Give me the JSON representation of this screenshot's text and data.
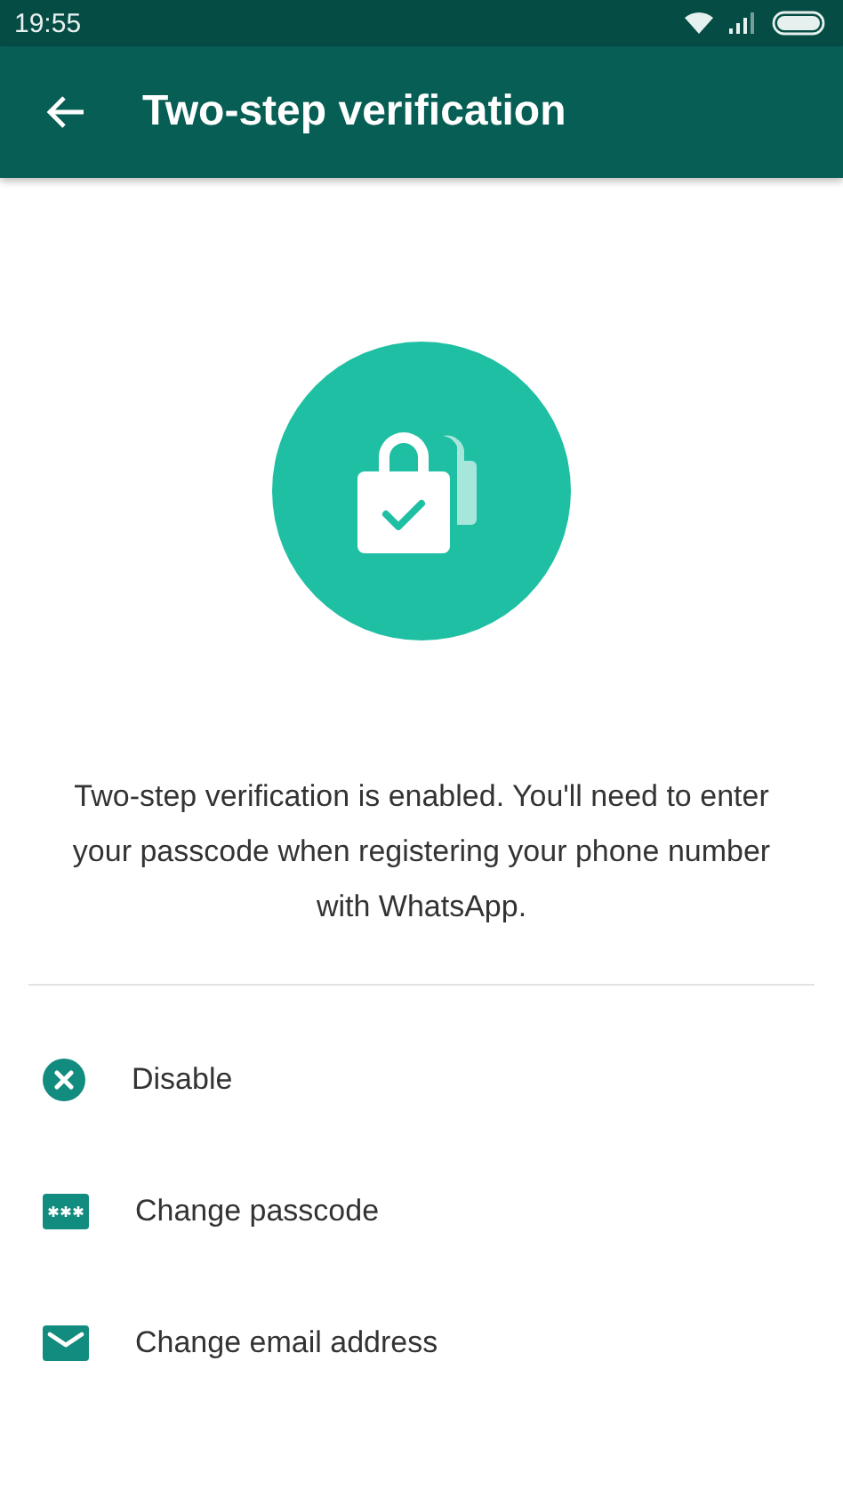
{
  "status_bar": {
    "time": "19:55"
  },
  "app_bar": {
    "title": "Two-step verification"
  },
  "message": "Two-step verification is enabled. You'll need to enter your passcode when registering your phone number with WhatsApp.",
  "options": [
    {
      "kind": "disable",
      "label": "Disable"
    },
    {
      "kind": "passcode",
      "label": "Change passcode"
    },
    {
      "kind": "email",
      "label": "Change email address"
    }
  ]
}
